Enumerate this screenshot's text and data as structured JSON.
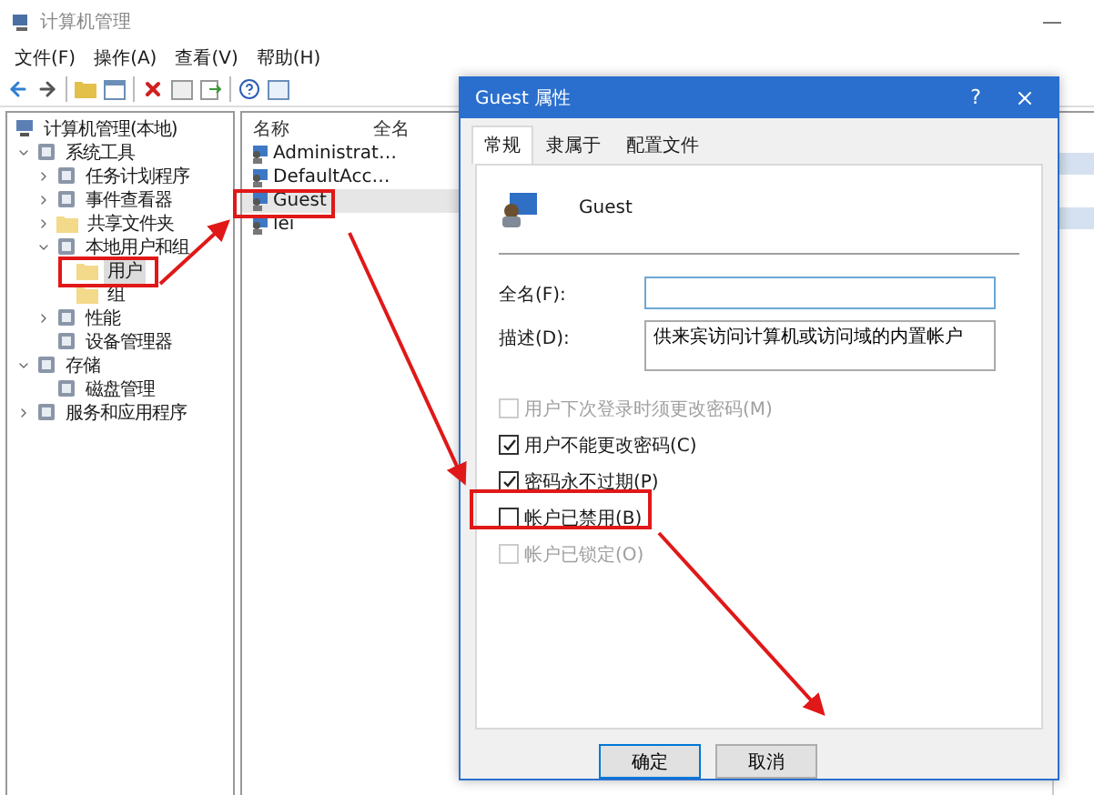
{
  "window": {
    "title": "计算机管理"
  },
  "menu": [
    {
      "label": "文件(F)"
    },
    {
      "label": "操作(A)"
    },
    {
      "label": "查看(V)"
    },
    {
      "label": "帮助(H)"
    }
  ],
  "tree": [
    {
      "label": "计算机管理(本地)",
      "kind": "computer",
      "selected": false,
      "children": [
        {
          "label": "系统工具",
          "kind": "tool",
          "expanded": true,
          "selected": false,
          "children": [
            {
              "label": "任务计划程序",
              "kind": "tool",
              "expanded": false,
              "selected": false
            },
            {
              "label": "事件查看器",
              "kind": "tool",
              "expanded": false,
              "selected": false
            },
            {
              "label": "共享文件夹",
              "kind": "folder",
              "expanded": false,
              "selected": false
            },
            {
              "label": "本地用户和组",
              "kind": "tool",
              "expanded": true,
              "selected": false,
              "children": [
                {
                  "label": "用户",
                  "kind": "folder",
                  "selected": true
                },
                {
                  "label": "组",
                  "kind": "folder",
                  "selected": false
                }
              ]
            },
            {
              "label": "性能",
              "kind": "tool",
              "expanded": false,
              "selected": false
            },
            {
              "label": "设备管理器",
              "kind": "tool",
              "selected": false
            }
          ]
        },
        {
          "label": "存储",
          "kind": "tool",
          "expanded": true,
          "selected": false,
          "children": [
            {
              "label": "磁盘管理",
              "kind": "tool",
              "selected": false
            }
          ]
        },
        {
          "label": "服务和应用程序",
          "kind": "tool",
          "expanded": false,
          "selected": false
        }
      ]
    }
  ],
  "list": {
    "columns": [
      "名称",
      "全名"
    ],
    "rows": [
      {
        "name": "Administrat…",
        "selected": false
      },
      {
        "name": "DefaultAcc…",
        "selected": false
      },
      {
        "name": "Guest",
        "selected": true
      },
      {
        "name": "lei",
        "selected": false
      }
    ]
  },
  "dialog": {
    "title": "Guest 属性",
    "help": "?",
    "tabs": [
      {
        "label": "常规",
        "selected": true
      },
      {
        "label": "隶属于",
        "selected": false
      },
      {
        "label": "配置文件",
        "selected": false
      }
    ],
    "user_name": "Guest",
    "fields": [
      {
        "label": "全名(F):",
        "focused": true
      },
      {
        "label": "描述(D):",
        "value": "供来宾访问计算机或访问域的内置帐户"
      }
    ],
    "checkboxes": [
      {
        "label": "用户下次登录时须更改密码(M)",
        "checked": false,
        "disabled": true
      },
      {
        "label": "用户不能更改密码(C)",
        "checked": true,
        "disabled": false
      },
      {
        "label": "密码永不过期(P)",
        "checked": true,
        "disabled": false
      },
      {
        "label": "帐户已禁用(B)",
        "checked": false,
        "disabled": false
      },
      {
        "label": "帐户已锁定(O)",
        "checked": false,
        "disabled": true
      }
    ],
    "buttons": [
      {
        "label": "确定",
        "default": true
      },
      {
        "label": "取消",
        "default": false
      }
    ]
  }
}
